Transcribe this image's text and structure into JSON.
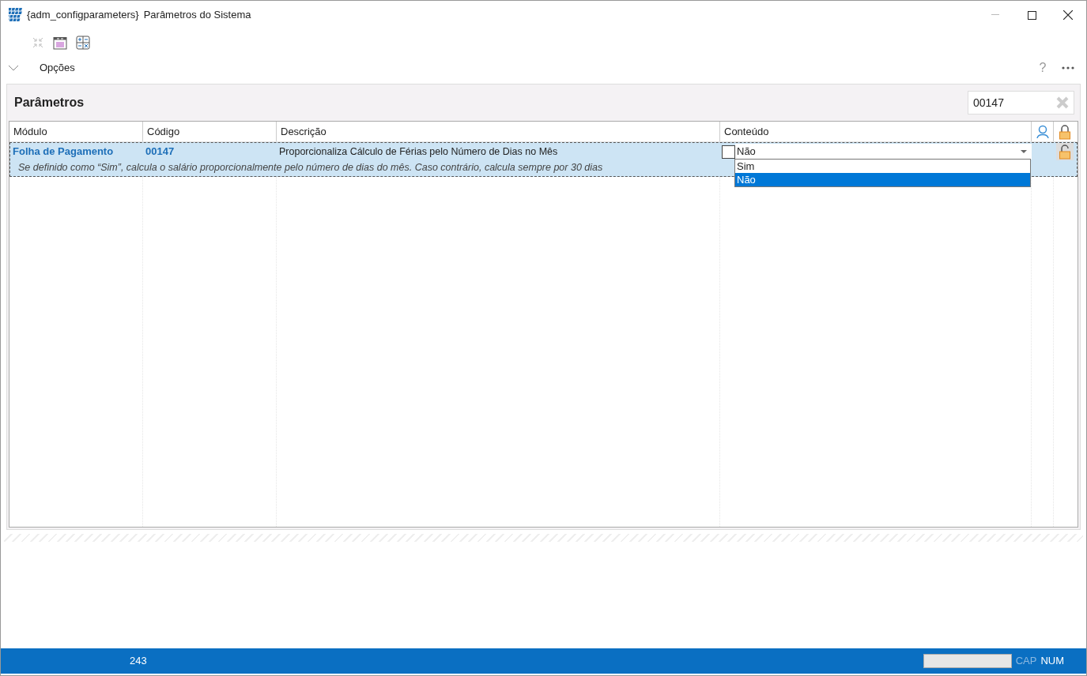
{
  "window": {
    "title": "{adm_configparameters}",
    "subtitle": "Parâmetros do Sistema"
  },
  "options": {
    "label": "Opções",
    "expanded": false,
    "help": "?"
  },
  "panel": {
    "title": "Parâmetros",
    "search": {
      "value": "00147"
    }
  },
  "table": {
    "columns": [
      "Módulo",
      "Código",
      "Descrição",
      "Conteúdo"
    ],
    "rows": [
      {
        "module": "Folha de Pagamento",
        "code": "00147",
        "description": "Proporcionaliza Cálculo de Férias pelo Número de Dias no Mês",
        "hint": "Se definido como “Sim”, calcula o salário proporcionalmente pelo número de dias do mês. Caso contrário, calcula sempre por 30 dias",
        "checked": false,
        "value": "Não",
        "selected": true,
        "dropdown": [
          {
            "label": "Sim",
            "selected": false
          },
          {
            "label": "Não",
            "selected": true
          }
        ]
      }
    ]
  },
  "status_bar": {
    "count": "243",
    "progress": {
      "level": 0
    },
    "indicators": [
      {
        "label": "CAP",
        "on": false
      },
      {
        "label": "NUM",
        "on": true
      }
    ]
  }
}
